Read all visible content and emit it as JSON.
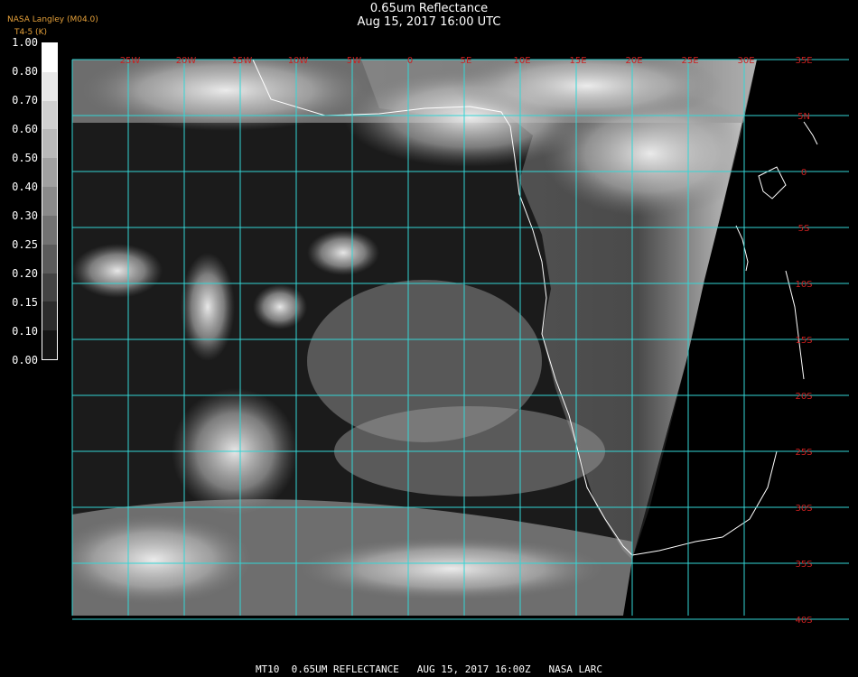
{
  "header": {
    "title": "0.65um Reflectance",
    "datetime": "Aug 15, 2017 16:00 UTC",
    "credit_line1": "NASA Langley (M04.0)",
    "credit_line2": "T4-5 (K)"
  },
  "colorbar": {
    "ticks": [
      "1.00",
      "0.80",
      "0.70",
      "0.60",
      "0.50",
      "0.40",
      "0.30",
      "0.25",
      "0.20",
      "0.15",
      "0.10",
      "0.00"
    ]
  },
  "map": {
    "grid_color": "#33d6d6",
    "label_color": "#cc1f1f",
    "lon_labels": [
      "25W",
      "20W",
      "15W",
      "10W",
      "5W",
      "0",
      "5E",
      "10E",
      "15E",
      "20E",
      "25E",
      "30E"
    ],
    "lat_labels": [
      "35E",
      "5N",
      "0",
      "5S",
      "10S",
      "15S",
      "20S",
      "25S",
      "30S",
      "35S",
      "40S"
    ]
  },
  "footer": {
    "text": "MT10  0.65UM REFLECTANCE   AUG 15, 2017 16:00Z   NASA LARC"
  }
}
